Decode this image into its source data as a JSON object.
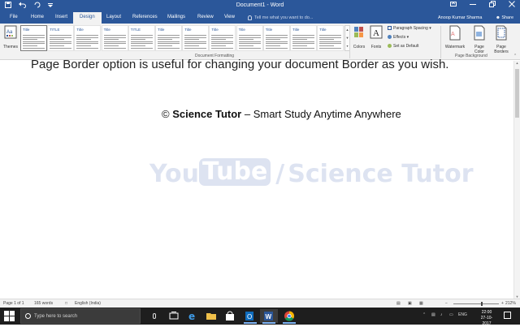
{
  "app": {
    "window_title": "Document1 - Word",
    "quick_access": [
      "save-icon",
      "undo-icon",
      "redo-icon",
      "customize-icon"
    ],
    "window_controls": [
      "ribbon-display-icon",
      "minimize-icon",
      "restore-icon",
      "close-icon"
    ]
  },
  "tabs": [
    {
      "label": "File",
      "active": false
    },
    {
      "label": "Home",
      "active": false
    },
    {
      "label": "Insert",
      "active": false
    },
    {
      "label": "Design",
      "active": true
    },
    {
      "label": "Layout",
      "active": false
    },
    {
      "label": "References",
      "active": false
    },
    {
      "label": "Mailings",
      "active": false
    },
    {
      "label": "Review",
      "active": false
    },
    {
      "label": "View",
      "active": false
    }
  ],
  "tell_me": {
    "placeholder": "Tell me what you want to do..."
  },
  "account": {
    "user": "Anoop Kumar Sharma",
    "share": "Share"
  },
  "ribbon": {
    "themes_label": "Themes",
    "style_tile_titles": [
      "Title",
      "TITLE",
      "Title",
      "Title",
      "TITLE",
      "Title",
      "Title",
      "Title",
      "Title",
      "Title",
      "Title",
      "Title"
    ],
    "document_formatting_label": "Document Formatting",
    "colors_label": "Colors",
    "fonts_label": "Fonts",
    "paragraph_spacing_label": "Paragraph Spacing",
    "effects_label": "Effects",
    "set_default_label": "Set as Default",
    "watermark_label": "Watermark",
    "page_color_label": "Page Color",
    "page_borders_label": "Page Borders",
    "page_background_label": "Page Background"
  },
  "document": {
    "line1": "Page Border option is useful for changing your document Border as you wish.",
    "copyright_symbol": "©",
    "brand": "Science Tutor",
    "tagline": " – Smart Study Anytime Anywhere",
    "watermark_you": "You",
    "watermark_tube": "Tube",
    "watermark_slash": "/",
    "watermark_channel": "Science Tutor"
  },
  "status": {
    "page": "Page 1 of 1",
    "words": "165 words",
    "language": "English (India)",
    "zoom": "212%",
    "zoom_fraction": 0.62
  },
  "taskbar": {
    "search_placeholder": "Type here to search",
    "apps": [
      "task-view-icon",
      "edge-icon",
      "file-explorer-icon",
      "store-icon",
      "outlook-icon",
      "word-icon",
      "chrome-icon"
    ],
    "language": "ENG",
    "time": "22:00",
    "date": "27-10-2017"
  },
  "colors": {
    "word_blue": "#2b579a",
    "taskbar": "#1e1e1e",
    "watermark": "#dde3f1"
  }
}
